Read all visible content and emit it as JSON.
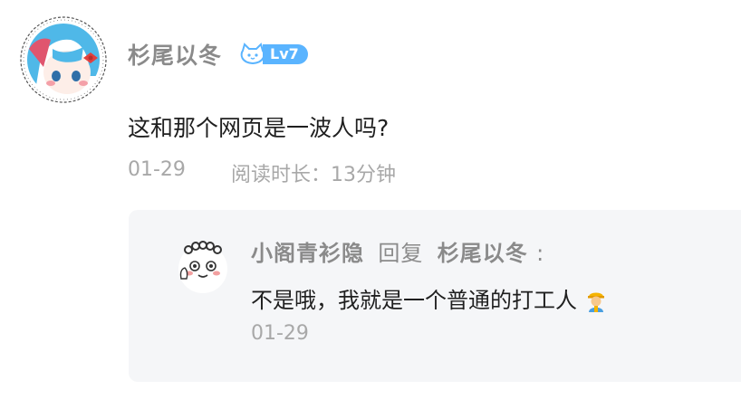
{
  "comment": {
    "username": "杉尾以冬",
    "level": "Lv7",
    "text": "这和那个网页是一波人吗?",
    "date": "01-29",
    "read_time": "阅读时长：13分钟"
  },
  "reply": {
    "author": "小阁青衫隐",
    "verb": "回复",
    "target": "杉尾以冬",
    "colon": ":",
    "text": "不是哦，我就是一个普通的打工人",
    "emoji": "construction-worker-emoji",
    "date": "01-29"
  },
  "colors": {
    "level_badge": "#5ab4ff",
    "reply_bg": "#f5f6f8",
    "muted_text": "#a8a8a8"
  }
}
